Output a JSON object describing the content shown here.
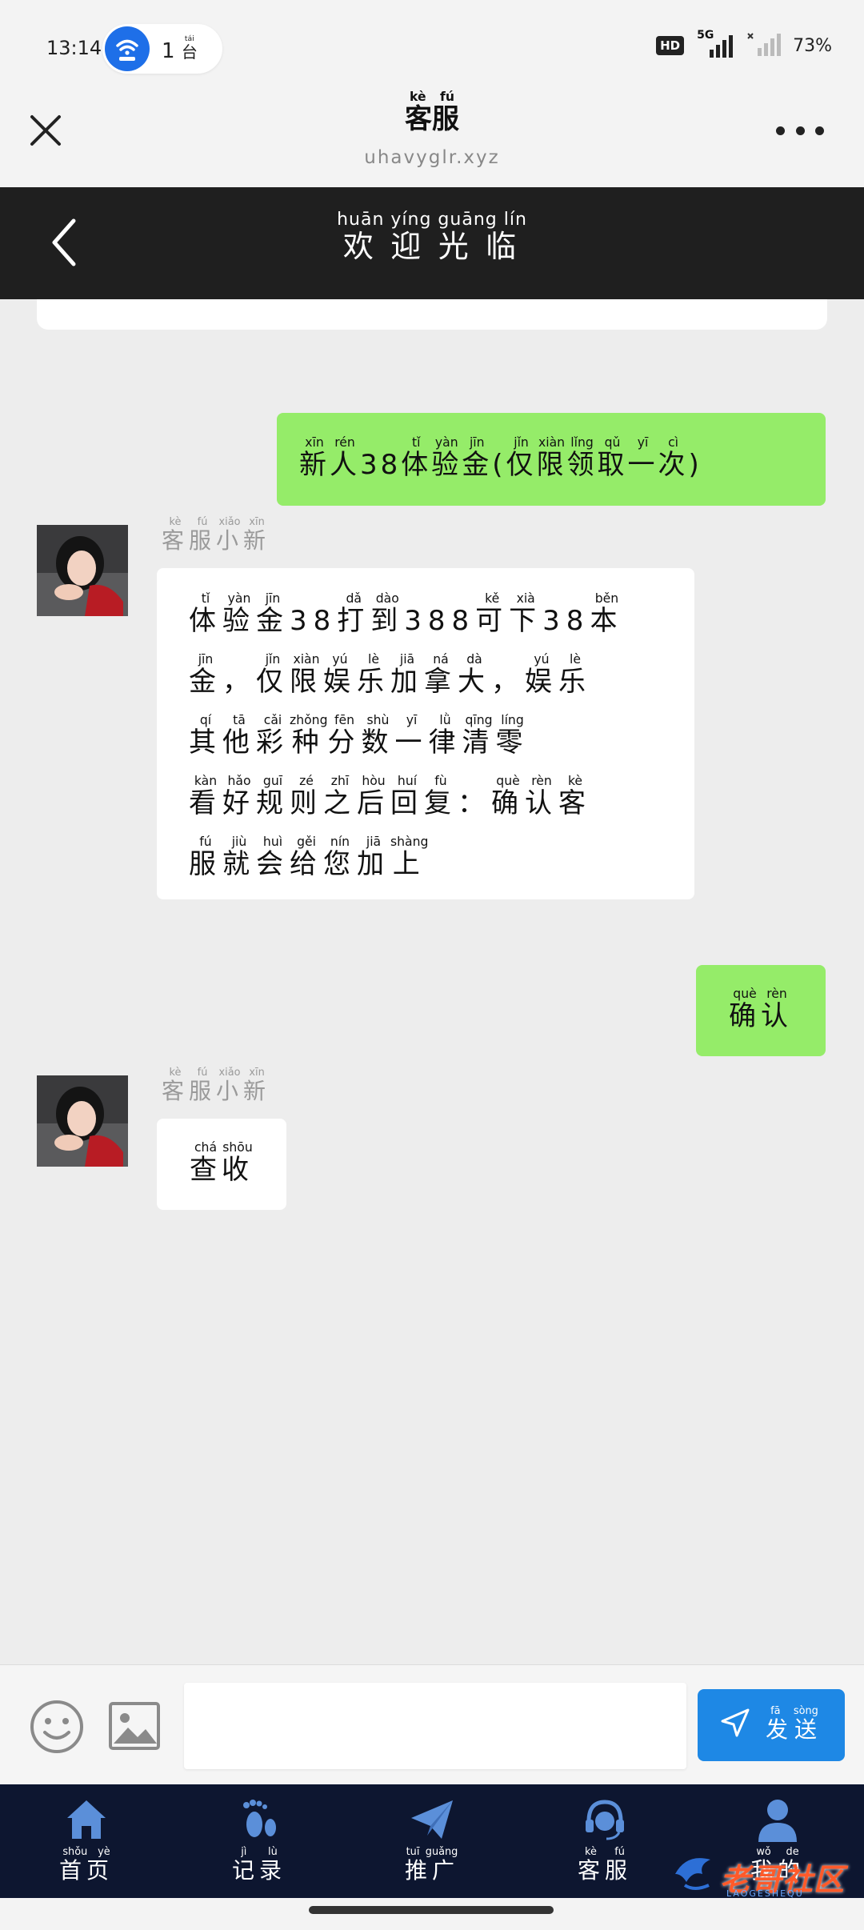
{
  "status": {
    "time": "13:14",
    "hotspot_count": "1",
    "hotspot_unit": "台",
    "hotspot_unit_py": "tái",
    "hd": "HD",
    "network": "5G",
    "battery": "73%"
  },
  "mini": {
    "title": "客服",
    "title_py": "kè fú",
    "domain": "uhavyglr.xyz"
  },
  "nav": {
    "title": "欢迎光临",
    "title_py": "huān yíng guāng lín"
  },
  "chat": {
    "m1": [
      [
        "新",
        "xīn"
      ],
      [
        "人",
        "rén"
      ],
      [
        "38",
        ""
      ],
      [
        "体",
        "tǐ"
      ],
      [
        "验",
        "yàn"
      ],
      [
        "金",
        "jīn"
      ],
      [
        "(",
        ""
      ],
      [
        "仅",
        "jǐn"
      ],
      [
        "限",
        "xiàn"
      ],
      [
        "领",
        "lǐng"
      ],
      [
        "取",
        "qǔ"
      ],
      [
        "一",
        "yī"
      ],
      [
        "次",
        "cì"
      ],
      [
        ")",
        ""
      ]
    ],
    "sender": [
      [
        "客",
        "kè"
      ],
      [
        "服",
        "fú"
      ],
      [
        "小",
        "xiǎo"
      ],
      [
        "新",
        "xīn"
      ]
    ],
    "m2_lines": [
      [
        [
          "体",
          "tǐ"
        ],
        [
          "验",
          "yàn"
        ],
        [
          "金",
          "jīn"
        ],
        [
          "38",
          ""
        ],
        [
          "打",
          "dǎ"
        ],
        [
          "到",
          "dào"
        ],
        [
          "388",
          ""
        ],
        [
          "可",
          "kě"
        ],
        [
          "下",
          "xià"
        ],
        [
          "38",
          ""
        ],
        [
          "本",
          "běn"
        ]
      ],
      [
        [
          "金",
          "jīn"
        ],
        [
          "，",
          ""
        ],
        [
          "仅",
          "jǐn"
        ],
        [
          "限",
          "xiàn"
        ],
        [
          "娱",
          "yú"
        ],
        [
          "乐",
          "lè"
        ],
        [
          "加",
          "jiā"
        ],
        [
          "拿",
          "ná"
        ],
        [
          "大",
          "dà"
        ],
        [
          "，",
          ""
        ],
        [
          "娱",
          "yú"
        ],
        [
          "乐",
          "lè"
        ]
      ],
      [
        [
          "其",
          "qí"
        ],
        [
          "他",
          "tā"
        ],
        [
          "彩",
          "cǎi"
        ],
        [
          "种",
          "zhǒng"
        ],
        [
          "分",
          "fēn"
        ],
        [
          "数",
          "shù"
        ],
        [
          "一",
          "yī"
        ],
        [
          "律",
          "lǜ"
        ],
        [
          "清",
          "qīng"
        ],
        [
          "零",
          "líng"
        ]
      ],
      [
        [
          "看",
          "kàn"
        ],
        [
          "好",
          "hǎo"
        ],
        [
          "规",
          "guī"
        ],
        [
          "则",
          "zé"
        ],
        [
          "之",
          "zhī"
        ],
        [
          "后",
          "hòu"
        ],
        [
          "回",
          "huí"
        ],
        [
          "复",
          "fù"
        ],
        [
          "：",
          ""
        ],
        [
          "确",
          "què"
        ],
        [
          "认",
          "rèn"
        ],
        [
          "客",
          "kè"
        ]
      ],
      [
        [
          "服",
          "fú"
        ],
        [
          "就",
          "jiù"
        ],
        [
          "会",
          "huì"
        ],
        [
          "给",
          "gěi"
        ],
        [
          "您",
          "nín"
        ],
        [
          "加",
          "jiā"
        ],
        [
          "上",
          "shàng"
        ]
      ]
    ],
    "m3": [
      [
        "确",
        "què"
      ],
      [
        "认",
        "rèn"
      ]
    ],
    "m4": [
      [
        "查",
        "chá"
      ],
      [
        "收",
        "shōu"
      ]
    ]
  },
  "input": {
    "placeholder": "",
    "send_label": "发送",
    "send_py": "fā sòng"
  },
  "tabs": [
    {
      "label": "首页",
      "py": "shǒu yè",
      "icon": "home-icon"
    },
    {
      "label": "记录",
      "py": "jì lù",
      "icon": "footprint-icon"
    },
    {
      "label": "推广",
      "py": "tuī guǎng",
      "icon": "paper-plane-icon"
    },
    {
      "label": "客服",
      "py": "kè fú",
      "icon": "headset-icon"
    },
    {
      "label": "我的",
      "py": "wǒ de",
      "icon": "user-icon"
    }
  ],
  "watermark": {
    "text": "老哥社区",
    "sub": "LAOGESHEQU"
  },
  "colors": {
    "accent": "#1e88e5",
    "outgoing_bubble": "#95ec69",
    "nav_bg": "#1f1f1f",
    "tabbar_bg": "#0d1630"
  }
}
